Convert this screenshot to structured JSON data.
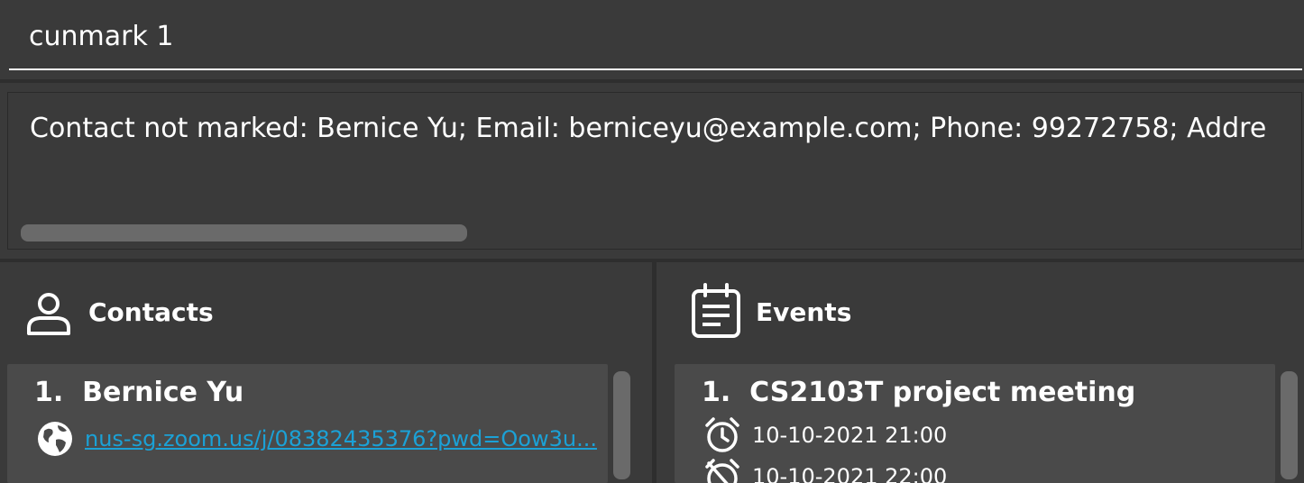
{
  "command": {
    "value": "cunmark 1"
  },
  "result": {
    "text": "Contact not marked: Bernice Yu; Email: berniceyu@example.com; Phone: 99272758; Addre"
  },
  "contacts": {
    "title": "Contacts",
    "icon": "person-icon",
    "items": [
      {
        "index": "1.",
        "name": "Bernice Yu",
        "link": "nus-sg.zoom.us/j/08382435376?pwd=Oow3u...",
        "link_icon": "globe-icon"
      }
    ]
  },
  "events": {
    "title": "Events",
    "icon": "calendar-note-icon",
    "items": [
      {
        "index": "1.",
        "name": "CS2103T project meeting",
        "start": "10-10-2021 21:00",
        "end": "10-10-2021 22:00"
      }
    ]
  },
  "colors": {
    "background": "#3a3a3a",
    "card": "#4a4a4a",
    "link": "#1ba1d6"
  }
}
